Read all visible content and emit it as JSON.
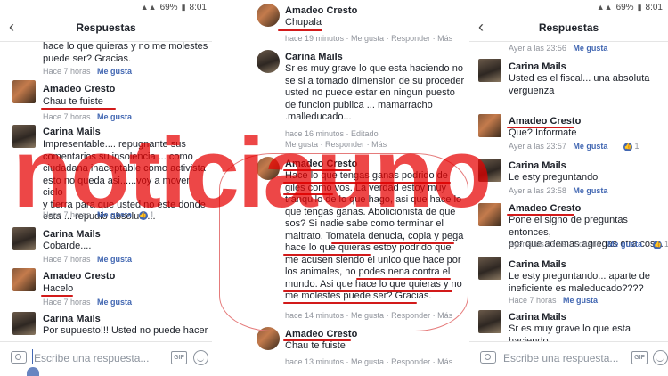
{
  "watermark": "noticiauno",
  "panel1": {
    "status": {
      "battery": "69%",
      "time": "8:01"
    },
    "header_title": "Respuestas",
    "comments": [
      {
        "name": "",
        "text": "hace lo que quieras y no me molestes\npuede ser? Gracias.",
        "meta_time": "Hace 7 horas",
        "like": "Me gusta"
      },
      {
        "name": "Amadeo Cresto",
        "text": "Chau te fuiste",
        "meta_time": "Hace 7 horas",
        "like": "Me gusta"
      },
      {
        "name": "Carina Mails",
        "text": "Impresentable.... repugnante sus\ncomentarios su insolencia ... como\nciudadana inaceptable como activista\nesto no queda asi......voy a mover cielo\ny tierra para que usted no este donde\nesta ... repudio absoluto...",
        "meta_time": "Hace 7 horas",
        "like": "Me gusta",
        "reactions": "1"
      },
      {
        "name": "Carina Mails",
        "text": "Cobarde....",
        "meta_time": "Hace 7 horas",
        "like": "Me gusta"
      },
      {
        "name": "Amadeo Cresto",
        "text": "Hacelo",
        "meta_time": "Hace 7 horas",
        "like": "Me gusta"
      },
      {
        "name": "Carina Mails",
        "text": "Por supuesto!!! Usted no puede hacer",
        "meta_time": "",
        "like": ""
      }
    ],
    "input_placeholder": "Escribe una respuesta...",
    "gif": "GIF"
  },
  "panel2": {
    "comments": [
      {
        "name": "Amadeo Cresto",
        "text": "Chupala",
        "meta_time": "hace 19 minutos",
        "like": "Me gusta",
        "reply": "Responder",
        "more": "Más"
      },
      {
        "name": "Carina Mails",
        "text": "Sr es muy grave lo que esta haciendo no\nse si a tomado dimension de su proceder\nusted no puede estar en ningun puesto\nde funcion publica ... mamarracho\n.malleducado...",
        "meta_time": "hace 16 minutos",
        "edited": "Editado",
        "like": "Me gusta",
        "reply": "Responder",
        "more": "Más"
      },
      {
        "name": "Amadeo Cresto",
        "text": "Hace lo que tengas ganas podrido de\ngiles como vos. La verdad estoy muy\ntranquilo de lo que hago, asi que hace lo\nque tengas ganas. Abolicionista de que\nsos? Si nadie sabe como terminar el\nmaltrato. Tomatela denucia, copia y pega\nhace lo que quieras estoy podrido que\nme acusen siendo el unico que hace por\nlos animales, no podes nena contra el\nmundo. Asi que hace lo que quieras y no\nme molestes puede ser? Gracias.",
        "meta_time": "hace 14 minutos",
        "like": "Me gusta",
        "reply": "Responder",
        "more": "Más"
      },
      {
        "name": "Amadeo Cresto",
        "text": "Chau te fuiste",
        "meta_time": "hace 13 minutos",
        "like": "Me gusta",
        "reply": "Responder",
        "more": "Más"
      }
    ]
  },
  "panel3": {
    "status": {
      "battery": "69%",
      "time": "8:01"
    },
    "header_title": "Respuestas",
    "comments": [
      {
        "name": "",
        "text": "",
        "meta_time": "Ayer a las 23:56",
        "like": "Me gusta"
      },
      {
        "name": "Carina Mails",
        "text": "Usted es el fiscal... una absoluta\nverguenza",
        "meta_time": "Ayer a las 23:56",
        "like": "Me gusta"
      },
      {
        "name": "Amadeo Cresto",
        "text": "Que? Informate",
        "meta_time": "Ayer a las 23:57",
        "like": "Me gusta",
        "reactions": "1"
      },
      {
        "name": "Carina Mails",
        "text": "Le esty preguntando",
        "meta_time": "Ayer a las 23:58",
        "like": "Me gusta"
      },
      {
        "name": "Amadeo Cresto",
        "text": "Pone el signo de preguntas entonces,\npor que ademas agregas otra cosa.",
        "meta_time": "Ayer a las 23:59",
        "edited": "Editado",
        "like": "Me gusta",
        "reactions": "1"
      },
      {
        "name": "Carina Mails",
        "text": "Le esty preguntando... aparte de\nineficiente es maleducado????",
        "meta_time": "Hace 7 horas",
        "like": "Me gusta"
      },
      {
        "name": "Carina Mails",
        "text": "Sr es muy grave lo que esta haciendo",
        "meta_time": "",
        "like": ""
      }
    ],
    "input_placeholder": "Escribe una respuesta...",
    "gif": "GIF"
  }
}
